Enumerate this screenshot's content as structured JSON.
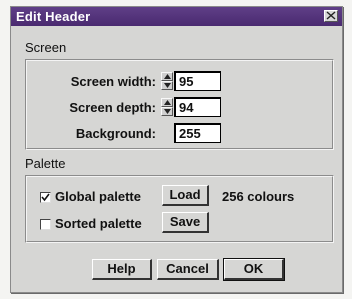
{
  "window": {
    "title": "Edit Header"
  },
  "screen": {
    "section_label": "Screen",
    "width_label": "Screen width:",
    "width_value": "95",
    "depth_label": "Screen depth:",
    "depth_value": "94",
    "background_label": "Background:",
    "background_value": "255"
  },
  "palette": {
    "section_label": "Palette",
    "global_label": "Global palette",
    "global_checked": true,
    "sorted_label": "Sorted palette",
    "sorted_checked": false,
    "load_label": "Load",
    "save_label": "Save",
    "colour_count": "256 colours"
  },
  "buttons": {
    "help": "Help",
    "cancel": "Cancel",
    "ok": "OK"
  },
  "colors": {
    "titlebar": "#4a2a70",
    "dialog": "#d6d6d4"
  }
}
